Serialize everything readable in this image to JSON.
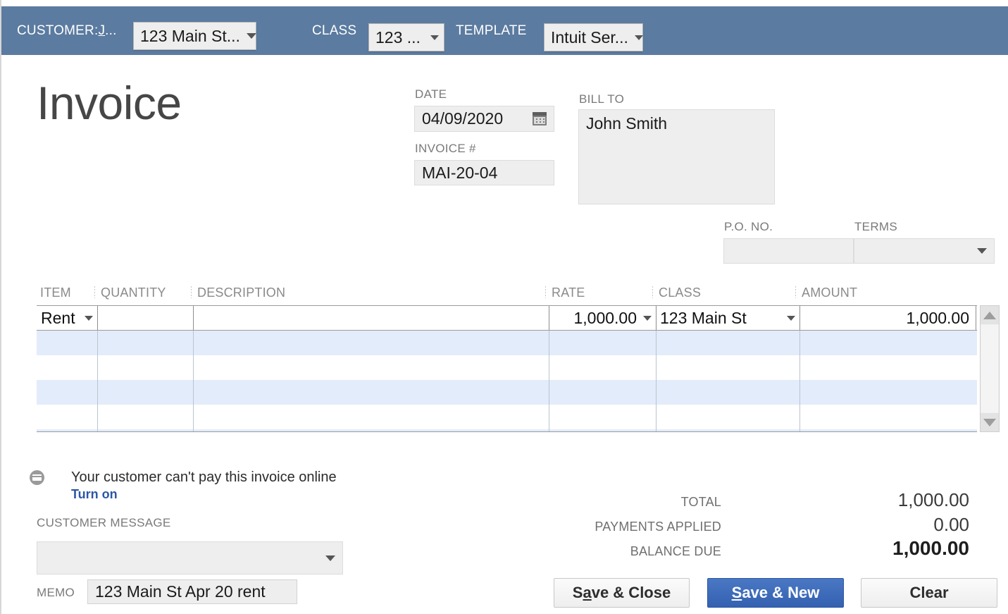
{
  "ribbon": {
    "customer_label_prefix": "CUSTOMER:",
    "customer_label_mnemonic": "J",
    "customer_label_suffix": "...",
    "customer_value": "123 Main St...",
    "class_label": "CLASS",
    "class_value": "123 ...",
    "template_label": "TEMPLATE",
    "template_value": "Intuit Ser...",
    "background_color": "#5b7ba0"
  },
  "form": {
    "title": "Invoice",
    "date_label": "DATE",
    "date_value": "04/09/2020",
    "date_icon": "calendar-icon",
    "invoice_no_label": "INVOICE #",
    "invoice_no_value": "MAI-20-04",
    "bill_to_label": "BILL TO",
    "bill_to_value": "John Smith",
    "po_no_label": "P.O. NO.",
    "po_no_value": "",
    "terms_label": "TERMS",
    "terms_value": ""
  },
  "line_items": {
    "columns": [
      "ITEM",
      "QUANTITY",
      "DESCRIPTION",
      "RATE",
      "CLASS",
      "AMOUNT"
    ],
    "rows": [
      {
        "item": "Rent",
        "quantity": "",
        "description": "",
        "rate": "1,000.00",
        "class": "123 Main St",
        "amount": "1,000.00"
      }
    ],
    "empty_row_count": 5,
    "stripe_color": "#e2ecfb"
  },
  "payment_notice": {
    "icon": "credit-card-icon",
    "text": "Your customer can't pay this invoice online",
    "link_label": "Turn on",
    "link_color": "#2b57a5"
  },
  "customer_message": {
    "label": "CUSTOMER MESSAGE",
    "value": ""
  },
  "memo": {
    "label": "MEMO",
    "value": "123 Main St Apr 20 rent"
  },
  "totals": [
    {
      "label": "TOTAL",
      "value": "1,000.00"
    },
    {
      "label": "PAYMENTS APPLIED",
      "value": "0.00"
    },
    {
      "label": "BALANCE DUE",
      "value": "1,000.00"
    }
  ],
  "buttons": {
    "save_close": {
      "pre": "S",
      "mnemonic": "a",
      "post": "ve & Close"
    },
    "save_new": {
      "pre": "",
      "mnemonic": "S",
      "post": "ave & New",
      "accent_color": "#3461b0"
    },
    "clear": {
      "label": "Clear"
    }
  }
}
